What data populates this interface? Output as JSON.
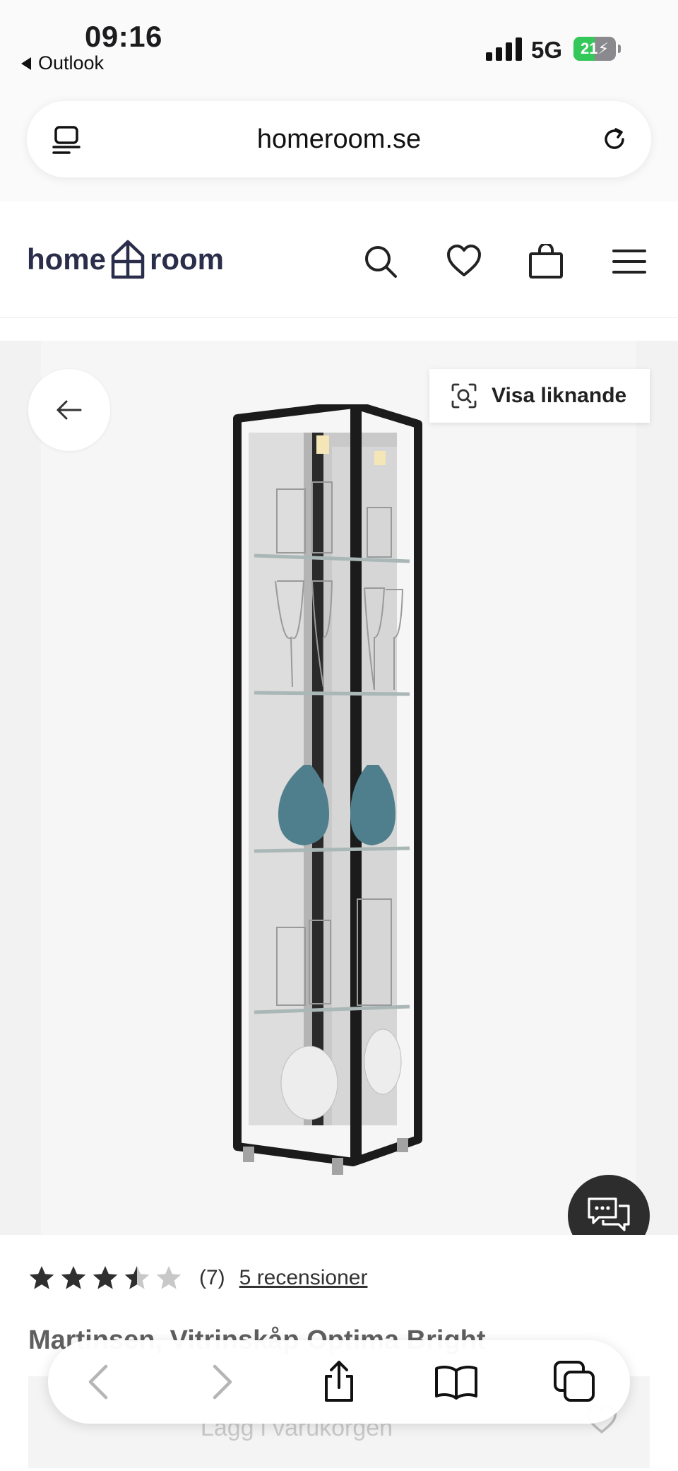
{
  "status_bar": {
    "time": "09:16",
    "back_app": "Outlook",
    "network": "5G",
    "battery_percent": 21,
    "battery_label": "21"
  },
  "browser": {
    "url": "homeroom.se"
  },
  "site_header": {
    "logo_left": "home",
    "logo_right": "room",
    "icons": [
      "search-icon",
      "heart-icon",
      "shopping-bag-icon",
      "menu-icon"
    ]
  },
  "gallery": {
    "similar_button_label": "Visa liknande"
  },
  "product": {
    "rating": 3.5,
    "rating_max": 5,
    "rating_count": "(7)",
    "reviews_link": "5 recensioner",
    "title": "Martinsen, Vitrinskåp Optima Bright",
    "add_to_cart": "Lägg i varukorgen"
  },
  "colors": {
    "brand_navy": "#2b2e4a",
    "star": "#2f2f2f",
    "star_empty": "#c8c8c8",
    "battery_green": "#34c759"
  }
}
